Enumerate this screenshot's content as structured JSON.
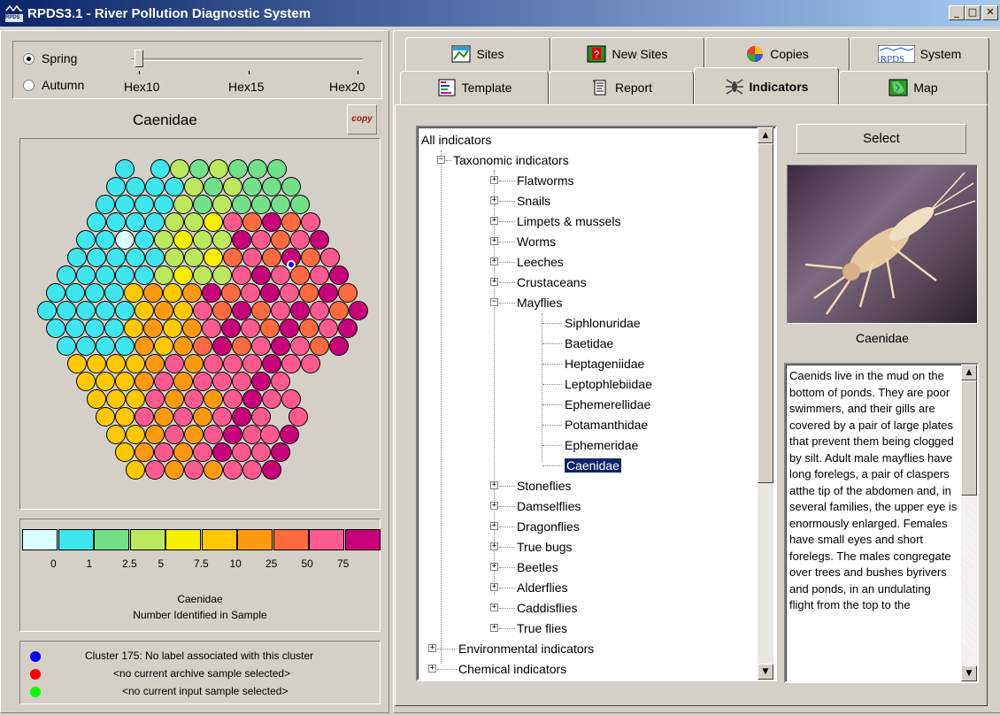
{
  "window": {
    "title": "RPDS3.1 - River Pollution Diagnostic System",
    "icon_label": "RPDS",
    "controls": [
      "_",
      "□",
      "✕"
    ]
  },
  "season": {
    "options": [
      {
        "label": "Spring",
        "selected": true
      },
      {
        "label": "Autumn",
        "selected": false
      }
    ]
  },
  "hex_slider": {
    "labels": [
      "Hex10",
      "Hex15",
      "Hex20"
    ],
    "value_label": "Hex10"
  },
  "map_panel": {
    "title": "Caenidae",
    "copy_label": "copy"
  },
  "legend": {
    "colors": [
      "#d9ffff",
      "#40e6ee",
      "#73e08a",
      "#bde85e",
      "#f6f000",
      "#ffc800",
      "#ff9a10",
      "#ff6a40",
      "#ff5a90",
      "#c8007a"
    ],
    "values": [
      "0",
      "1",
      "2.5",
      "5",
      "7.5",
      "10",
      "25",
      "50",
      "75"
    ],
    "line1": "Caenidae",
    "line2": "Number Identified in Sample"
  },
  "cluster_info": {
    "items": [
      {
        "color": "#0000ff",
        "text": "Cluster 175: No label associated with this cluster"
      },
      {
        "color": "#ff0000",
        "text": "<no current archive sample selected>"
      },
      {
        "color": "#00ff00",
        "text": "<no current input sample selected>"
      }
    ]
  },
  "tabs": {
    "row1": [
      {
        "label": "Sites",
        "icon": "sites-icon"
      },
      {
        "label": "New Sites",
        "icon": "new-sites-icon"
      },
      {
        "label": "Copies",
        "icon": "copies-icon"
      },
      {
        "label": "System",
        "icon": "rpds-system-icon",
        "badge": "RPDS"
      }
    ],
    "row2": [
      {
        "label": "Template",
        "icon": "template-icon"
      },
      {
        "label": "Report",
        "icon": "report-icon"
      },
      {
        "label": "Indicators",
        "icon": "indicators-icon",
        "active": true
      },
      {
        "label": "Map",
        "icon": "map-icon"
      }
    ]
  },
  "tree": {
    "root": "All indicators",
    "taxonomic": "Taxonomic indicators",
    "groups_before": [
      "Flatworms",
      "Snails",
      "Limpets & mussels",
      "Worms",
      "Leeches",
      "Crustaceans"
    ],
    "mayflies": "Mayflies",
    "mayfly_families": [
      "Siphlonuridae",
      "Baetidae",
      "Heptageniidae",
      "Leptophlebiidae",
      "Ephemerellidae",
      "Potamanthidae",
      "Ephemeridae",
      "Caenidae"
    ],
    "selected": "Caenidae",
    "groups_after": [
      "Stoneflies",
      "Damselflies",
      "Dragonflies",
      "True bugs",
      "Beetles",
      "Alderflies",
      "Caddisflies",
      "True flies"
    ],
    "top_after": [
      "Environmental indicators",
      "Chemical indicators"
    ]
  },
  "detail": {
    "select_label": "Select",
    "photo_caption": "Caenidae",
    "description": "Caenids live in the mud on the bottom of ponds. They are poor swimmers, and their gills are covered by a pair of large plates that prevent them being clogged by silt. Adult male mayflies have long forelegs, a pair of claspers atthe tip of the abdomen and, in several families, the upper eye is enormously enlarged. Females have small eyes and short forelegs. The males congregate over trees and bushes byrivers and ponds, in an undulating flight from the top to the"
  }
}
